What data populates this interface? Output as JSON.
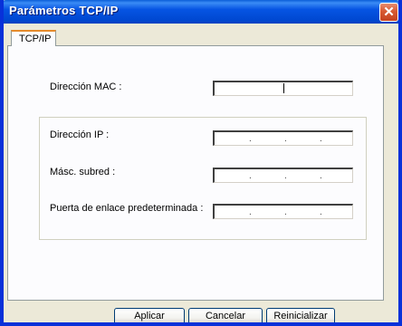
{
  "window": {
    "title": "Parámetros TCP/IP"
  },
  "tabs": [
    {
      "label": "TCP/IP",
      "selected": true
    }
  ],
  "fields": {
    "mac": {
      "label": "Dirección MAC :",
      "value": ""
    },
    "ip": {
      "label": "Dirección IP :",
      "separators": [
        ".",
        ".",
        "."
      ]
    },
    "subnet": {
      "label": "Másc. subred :",
      "separators": [
        ".",
        ".",
        "."
      ]
    },
    "gateway": {
      "label": "Puerta de enlace predeterminada :",
      "separators": [
        ".",
        ".",
        "."
      ]
    }
  },
  "buttons": {
    "apply": "Aplicar",
    "cancel": "Cancelar",
    "reset": "Reinicializar"
  },
  "colors": {
    "titlebar": "#0054e3",
    "close": "#d85a32",
    "tab_highlight": "#e68b2c",
    "dialog_bg": "#ece9d8"
  },
  "icons": {
    "close": "close-icon"
  }
}
